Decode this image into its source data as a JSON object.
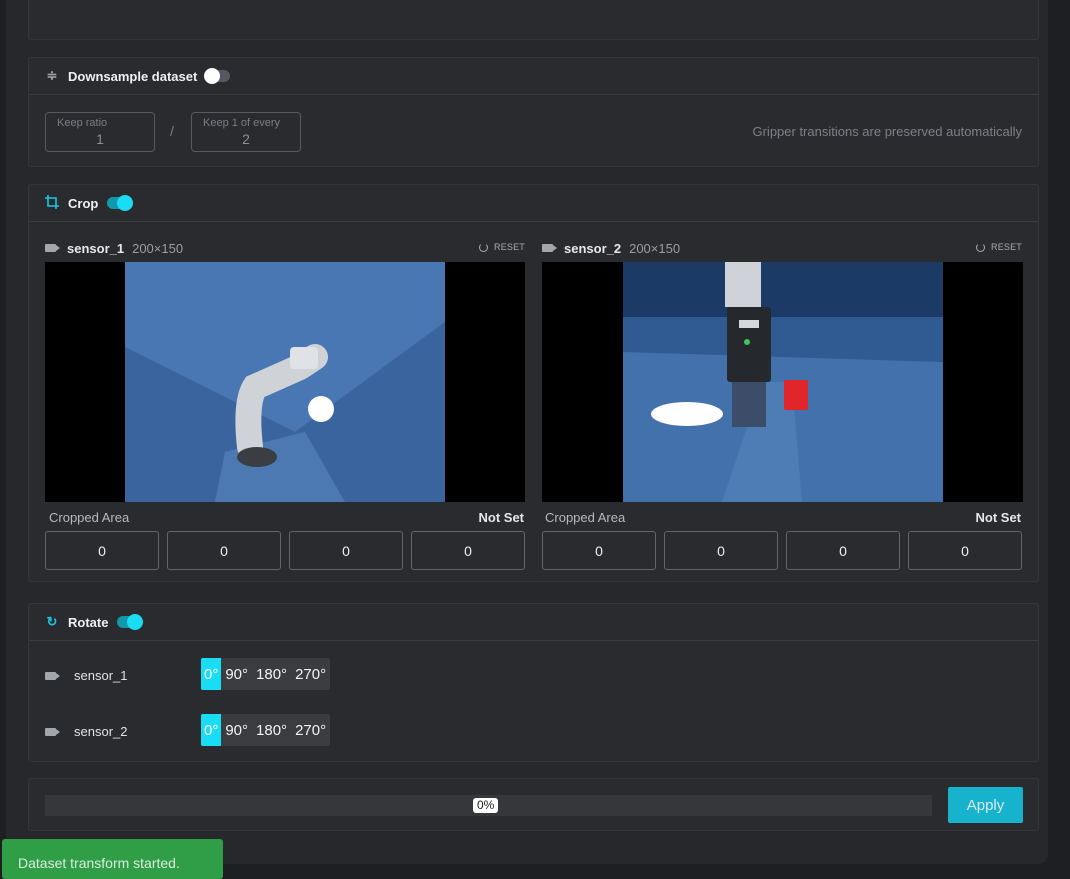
{
  "colors": {
    "accent": "#19dcf5",
    "toast_bg": "#2f9e47",
    "apply_bg": "#17b3cd"
  },
  "downsample": {
    "title": "Downsample dataset",
    "enabled": false,
    "keep_ratio_label": "Keep ratio",
    "keep_ratio_value": "1",
    "separator": "/",
    "keep_every_label": "Keep 1 of every",
    "keep_every_value": "2",
    "hint": "Gripper transitions are preserved automatically"
  },
  "crop": {
    "title": "Crop",
    "enabled": true,
    "sensors": [
      {
        "name": "sensor_1",
        "dims": "200×150",
        "reset_label": "RESET",
        "cropped_area_label": "Cropped Area",
        "status": "Not Set",
        "values": [
          "0",
          "0",
          "0",
          "0"
        ]
      },
      {
        "name": "sensor_2",
        "dims": "200×150",
        "reset_label": "RESET",
        "cropped_area_label": "Cropped Area",
        "status": "Not Set",
        "values": [
          "0",
          "0",
          "0",
          "0"
        ]
      }
    ]
  },
  "rotate": {
    "title": "Rotate",
    "enabled": true,
    "rows": [
      {
        "sensor": "sensor_1",
        "options": [
          "0°",
          "90°",
          "180°",
          "270°"
        ],
        "selected": "0°"
      },
      {
        "sensor": "sensor_2",
        "options": [
          "0°",
          "90°",
          "180°",
          "270°"
        ],
        "selected": "0°"
      }
    ]
  },
  "footer": {
    "progress": "0%",
    "progress_value": 0,
    "apply_label": "Apply"
  },
  "toast": {
    "message": "Dataset transform started."
  }
}
